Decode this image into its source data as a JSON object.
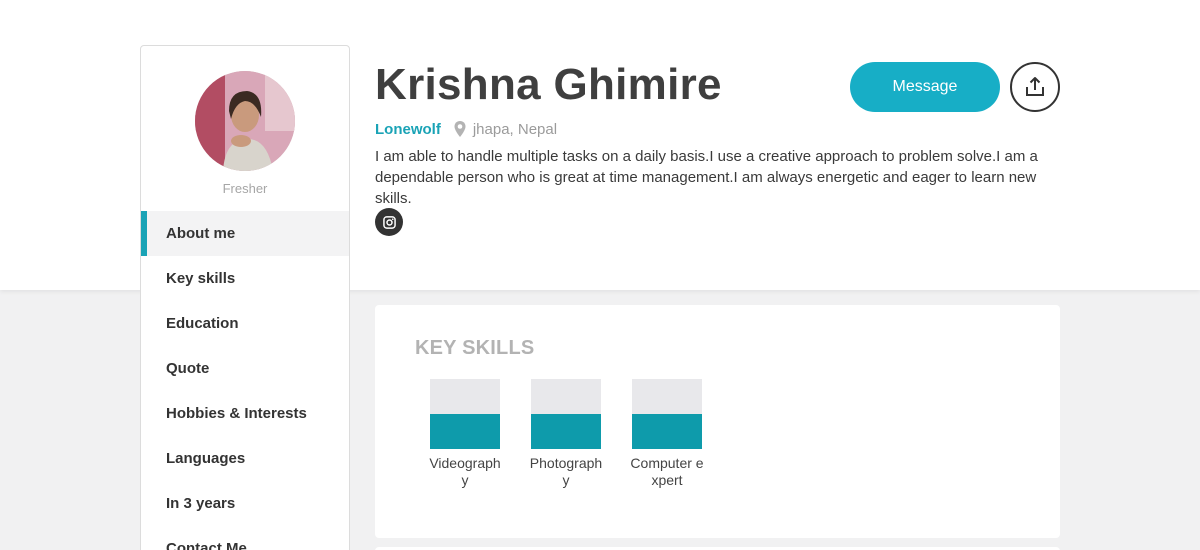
{
  "profile": {
    "name": "Krishna Ghimire",
    "nickname": "Lonewolf",
    "location": "jhapa, Nepal",
    "status": "Fresher",
    "bio": "I am able to handle multiple tasks on a daily basis.I use a creative approach to problem solve.I am a dependable person who is great at time management.I am always energetic and eager to learn new skills."
  },
  "actions": {
    "message_label": "Message",
    "share_icon": "share-icon",
    "social_icon": "instagram-icon"
  },
  "sidebar": {
    "items": [
      {
        "label": "About me",
        "active": true
      },
      {
        "label": "Key skills"
      },
      {
        "label": "Education"
      },
      {
        "label": "Quote"
      },
      {
        "label": "Hobbies & Interests"
      },
      {
        "label": "Languages"
      },
      {
        "label": "In 3 years"
      },
      {
        "label": "Contact Me"
      }
    ]
  },
  "skills": {
    "title": "KEY SKILLS",
    "items": [
      {
        "label": "Videography",
        "level": 0.5
      },
      {
        "label": "Photography",
        "level": 0.5
      },
      {
        "label": "Computer expert",
        "level": 0.5
      }
    ]
  },
  "colors": {
    "accent": "#17aec6",
    "skill_fill": "#0e9bab",
    "skill_track": "#e8e8eb",
    "dark": "#333333"
  }
}
